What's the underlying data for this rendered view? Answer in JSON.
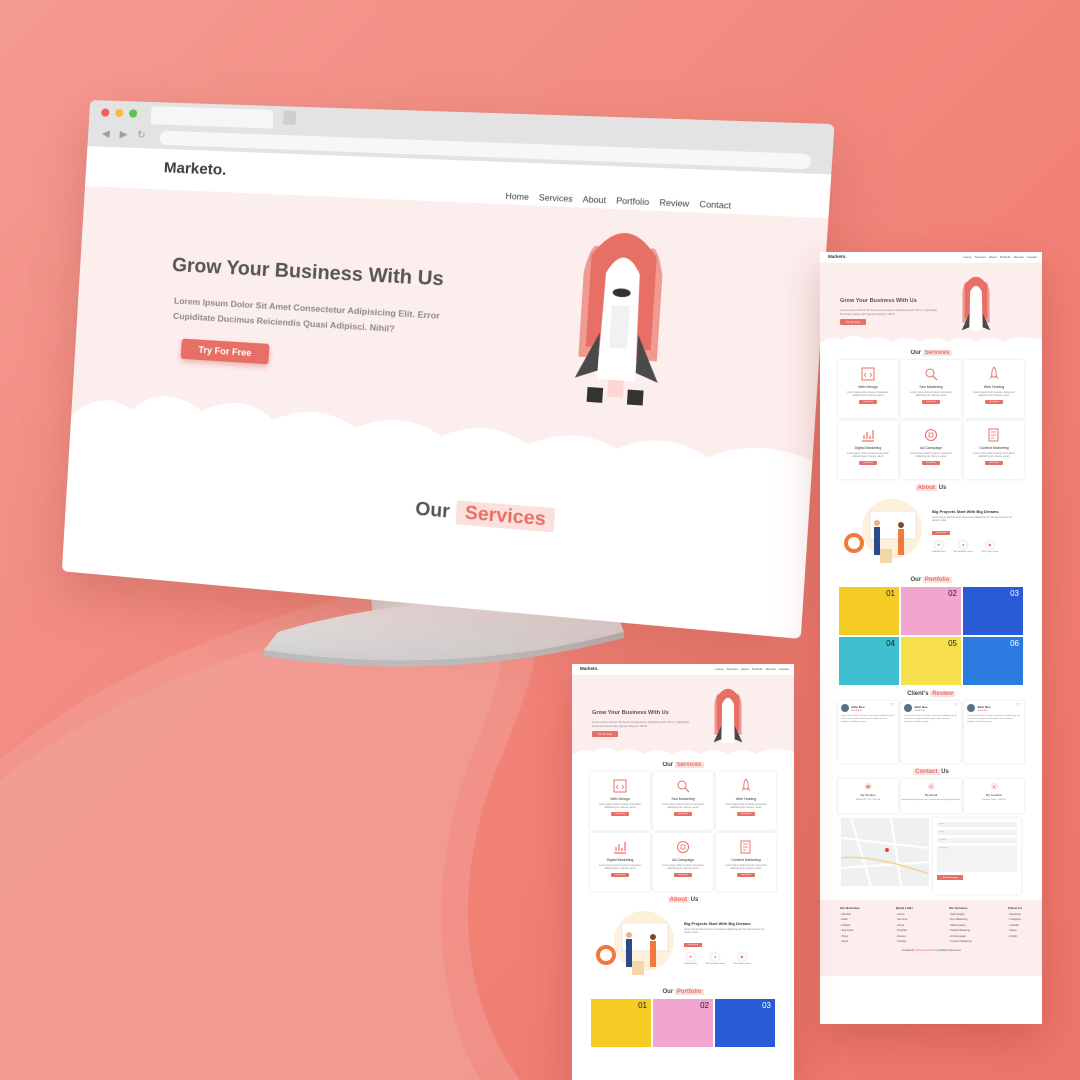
{
  "brand": "Marketo.",
  "nav": [
    "Home",
    "Services",
    "About",
    "Portfolio",
    "Review",
    "Contact"
  ],
  "hero": {
    "title": "Grow Your Business With Us",
    "subtitle": "Lorem Ipsum Dolor Sit Amet Consectetur Adipisicing Elit. Error Cupiditate Ducimus Reiciendis Quasi Adipisci. Nihil?",
    "cta": "Try For Free"
  },
  "services_heading": {
    "our": "Our",
    "highlight": "Services"
  },
  "services": [
    {
      "name": "Web Design",
      "icon": "code-window-icon"
    },
    {
      "name": "Seo Marketing",
      "icon": "magnifier-chart-icon"
    },
    {
      "name": "Web Hosting",
      "icon": "rocket-icon"
    },
    {
      "name": "Digital Marketing",
      "icon": "bar-chart-icon"
    },
    {
      "name": "Ad Campaign",
      "icon": "megaphone-icon"
    },
    {
      "name": "Content Marketing",
      "icon": "document-pen-icon"
    }
  ],
  "service_desc": "Lorem ipsum dolor sit amet consectetur adipisicing elit. Facere, amet!",
  "learn_more": "Learn More",
  "about_heading": {
    "our": "Us",
    "highlight": "About"
  },
  "about": {
    "title": "Big Projects Start With Big Dreams",
    "desc": "Lorem ipsum dolor sit amet consectetur adipisicing elit. Illo ipsa nesciunt vel quidem nobis.",
    "button": "Learn More",
    "stats": [
      "6 Award Wins",
      "180 Satisfied Clients",
      "180 Project Done"
    ]
  },
  "portfolio_heading": {
    "our": "Our",
    "highlight": "Portfolio"
  },
  "portfolio": [
    "01",
    "02",
    "03",
    "04",
    "05",
    "06"
  ],
  "review_heading": {
    "our": "Client's",
    "highlight": "Review"
  },
  "reviews": [
    {
      "name": "John Deo",
      "stars": "★★★★★"
    },
    {
      "name": "John Deo",
      "stars": "★★★★★"
    },
    {
      "name": "John Deo",
      "stars": "★★★★★"
    }
  ],
  "review_text": "Lorem ipsum dolor sit amet consectetur adipisicing elit. Vitae nisi ut quidem doloremque, dolor laborum voluptas aut officia saepe.",
  "contact_heading": {
    "our": "Us",
    "highlight": "Contact"
  },
  "contacts": [
    {
      "title": "My Number",
      "value": "9988-0087 / 111-2387-98",
      "icon": "phone-icon"
    },
    {
      "title": "My Email",
      "value": "mkquestdev@hotmail.com / marketodevelopers@gmail.com",
      "icon": "mail-icon"
    },
    {
      "title": "My Location",
      "value": "Mumbai, India - 400104",
      "icon": "location-pin-icon"
    }
  ],
  "form": {
    "name": "name",
    "email": "email",
    "number": "number",
    "message": "message",
    "button": "Send Message"
  },
  "footer": {
    "columns": [
      {
        "heading": "Our Branches",
        "items": [
          "Mumbai",
          "Delhi",
          "Kolkata",
          "Sao Paulo",
          "Tokyo",
          "Seoul"
        ]
      },
      {
        "heading": "Quick Links",
        "items": [
          "Home",
          "Services",
          "About",
          "Portfolio",
          "Review",
          "Contact"
        ]
      },
      {
        "heading": "Our Services",
        "items": [
          "Web Design",
          "Seo Marketing",
          "Web Hosting",
          "Digital Marketing",
          "Ad Campaign",
          "Content Marketing"
        ]
      },
      {
        "heading": "Follow Us",
        "items": [
          "Facebook",
          "Instagram",
          "Linkedin",
          "Twitter",
          "Github"
        ]
      }
    ],
    "credit_prefix": "Created By",
    "credit_name": "Mohamed Rashid",
    "credit_suffix": "| All Rights Reserved"
  },
  "colors": {
    "accent": "#e86f66",
    "hero_bg": "#fdeeee",
    "background": "#f28378"
  }
}
